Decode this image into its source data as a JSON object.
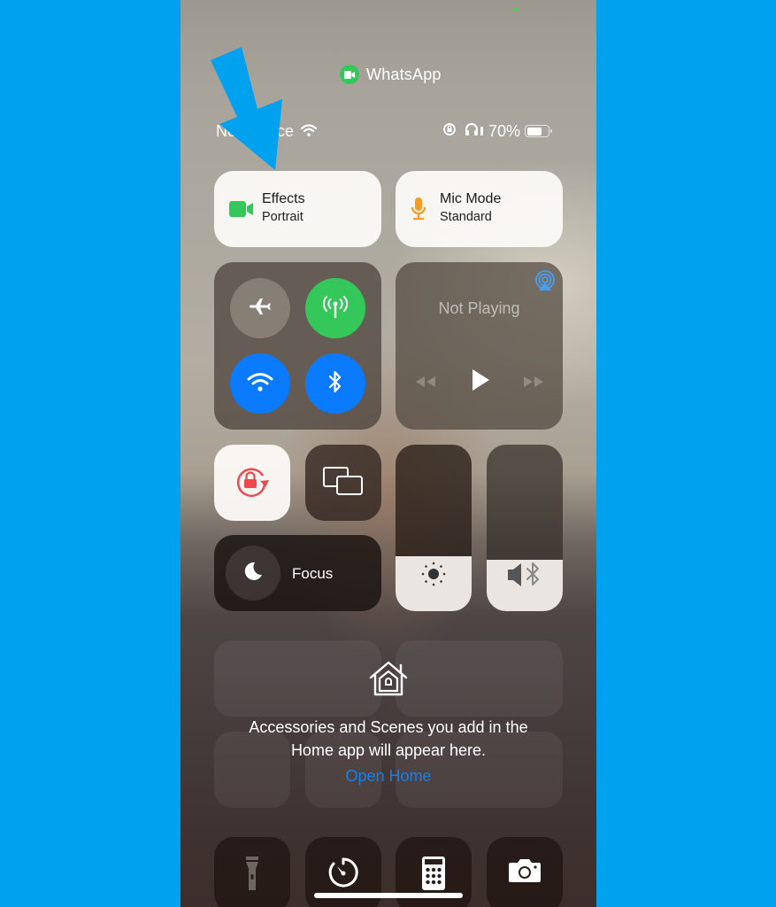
{
  "app_indicator": {
    "name": "WhatsApp",
    "icon": "video-camera-icon",
    "color": "#34c759"
  },
  "status_bar": {
    "carrier": "No Service",
    "wifi_icon": "wifi-icon",
    "orientation_lock_icon": "orientation-lock-icon",
    "headphones_icon": "headphones-icon",
    "battery_percent": "70%",
    "battery_level": 0.7
  },
  "controls": {
    "effects": {
      "title": "Effects",
      "subtitle": "Portrait",
      "icon": "video-camera-icon",
      "color": "#34c759"
    },
    "mic_mode": {
      "title": "Mic Mode",
      "subtitle": "Standard",
      "icon": "microphone-icon",
      "color": "#f59a23"
    },
    "connectivity": {
      "airplane_mode": {
        "icon": "airplane-icon",
        "on": false
      },
      "cellular_data": {
        "icon": "antenna-icon",
        "on": true,
        "color": "#34c759"
      },
      "wifi": {
        "icon": "wifi-icon",
        "on": true,
        "color": "#0a7aff"
      },
      "bluetooth": {
        "icon": "bluetooth-icon",
        "on": true,
        "color": "#0a7aff"
      }
    },
    "now_playing": {
      "title": "Not Playing",
      "airplay_icon": "airplay-icon"
    },
    "orientation_lock": {
      "icon": "rotation-lock-icon",
      "on": true,
      "color": "#f0474f"
    },
    "screen_mirroring": {
      "icon": "screen-mirroring-icon"
    },
    "focus": {
      "label": "Focus",
      "icon": "moon-icon"
    },
    "brightness": {
      "icon": "sun-icon",
      "level": 0.33
    },
    "volume": {
      "icon": "speaker-bluetooth-icon",
      "level": 0.31
    }
  },
  "home": {
    "icon": "home-icon",
    "message_line1": "Accessories and Scenes you add in the",
    "message_line2": "Home app will appear here.",
    "link": "Open Home",
    "link_color": "#1e7fe0"
  },
  "bottom_row": [
    {
      "name": "flashlight",
      "icon": "flashlight-icon"
    },
    {
      "name": "timer",
      "icon": "timer-icon"
    },
    {
      "name": "calculator",
      "icon": "calculator-icon"
    },
    {
      "name": "camera",
      "icon": "camera-icon"
    }
  ],
  "annotation": {
    "arrow_color": "#00a2f0",
    "arrow_target": "effects"
  }
}
